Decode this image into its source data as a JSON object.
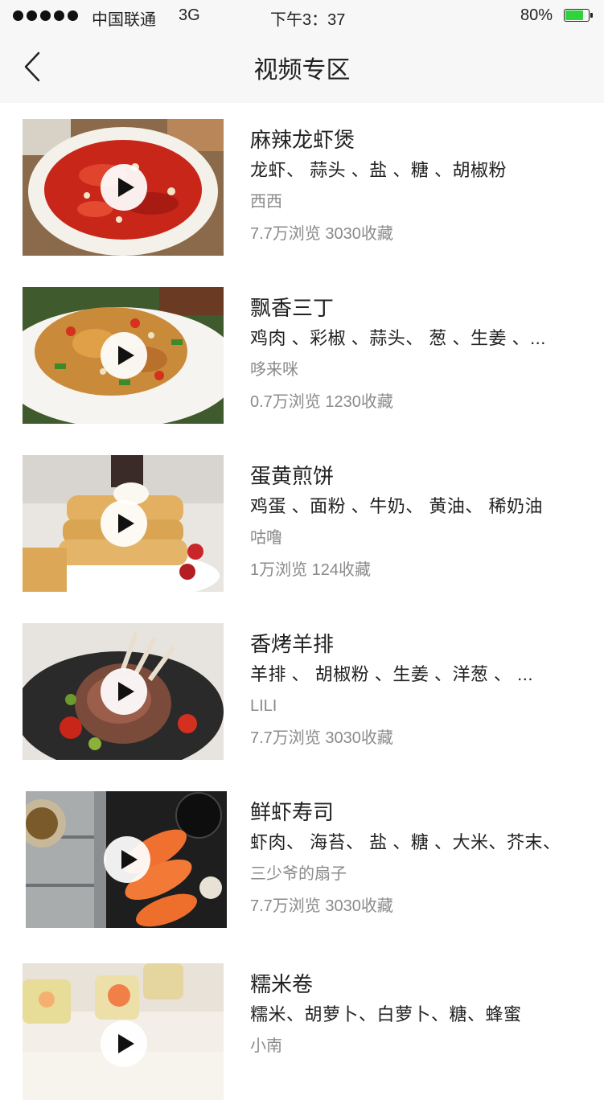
{
  "status_bar": {
    "carrier": "中国联通",
    "network": "3G",
    "time": "下午3：37",
    "battery_percent": "80%",
    "battery_level": 0.8,
    "battery_color": "#2fd33c"
  },
  "nav": {
    "title": "视频专区",
    "back_icon": "chevron-left-icon"
  },
  "recipes": [
    {
      "title": "麻辣龙虾煲",
      "ingredients": "龙虾、 蒜头 、盐 、糖 、胡椒粉",
      "author": "西西",
      "stats": "7.7万浏览 3030收藏"
    },
    {
      "title": "飘香三丁",
      "ingredients": "鸡肉 、彩椒 、蒜头、 葱 、生姜 、...",
      "author": "哆来咪",
      "stats": "0.7万浏览 1230收藏"
    },
    {
      "title": "蛋黄煎饼",
      "ingredients": "鸡蛋 、面粉 、牛奶、 黄油、 稀奶油",
      "author": "咕噜",
      "stats": "1万浏览 124收藏"
    },
    {
      "title": "香烤羊排",
      "ingredients": "羊排 、 胡椒粉 、生姜 、洋葱 、 ...",
      "author": "LILI",
      "stats": "7.7万浏览 3030收藏"
    },
    {
      "title": "鲜虾寿司",
      "ingredients": "虾肉、 海苔、 盐 、糖 、大米、芥末、",
      "author": "三少爷的扇子",
      "stats": "7.7万浏览 3030收藏"
    },
    {
      "title": "糯米卷",
      "ingredients": "糯米、胡萝卜、白萝卜、糖、蜂蜜",
      "author": "小南",
      "stats": ""
    }
  ]
}
